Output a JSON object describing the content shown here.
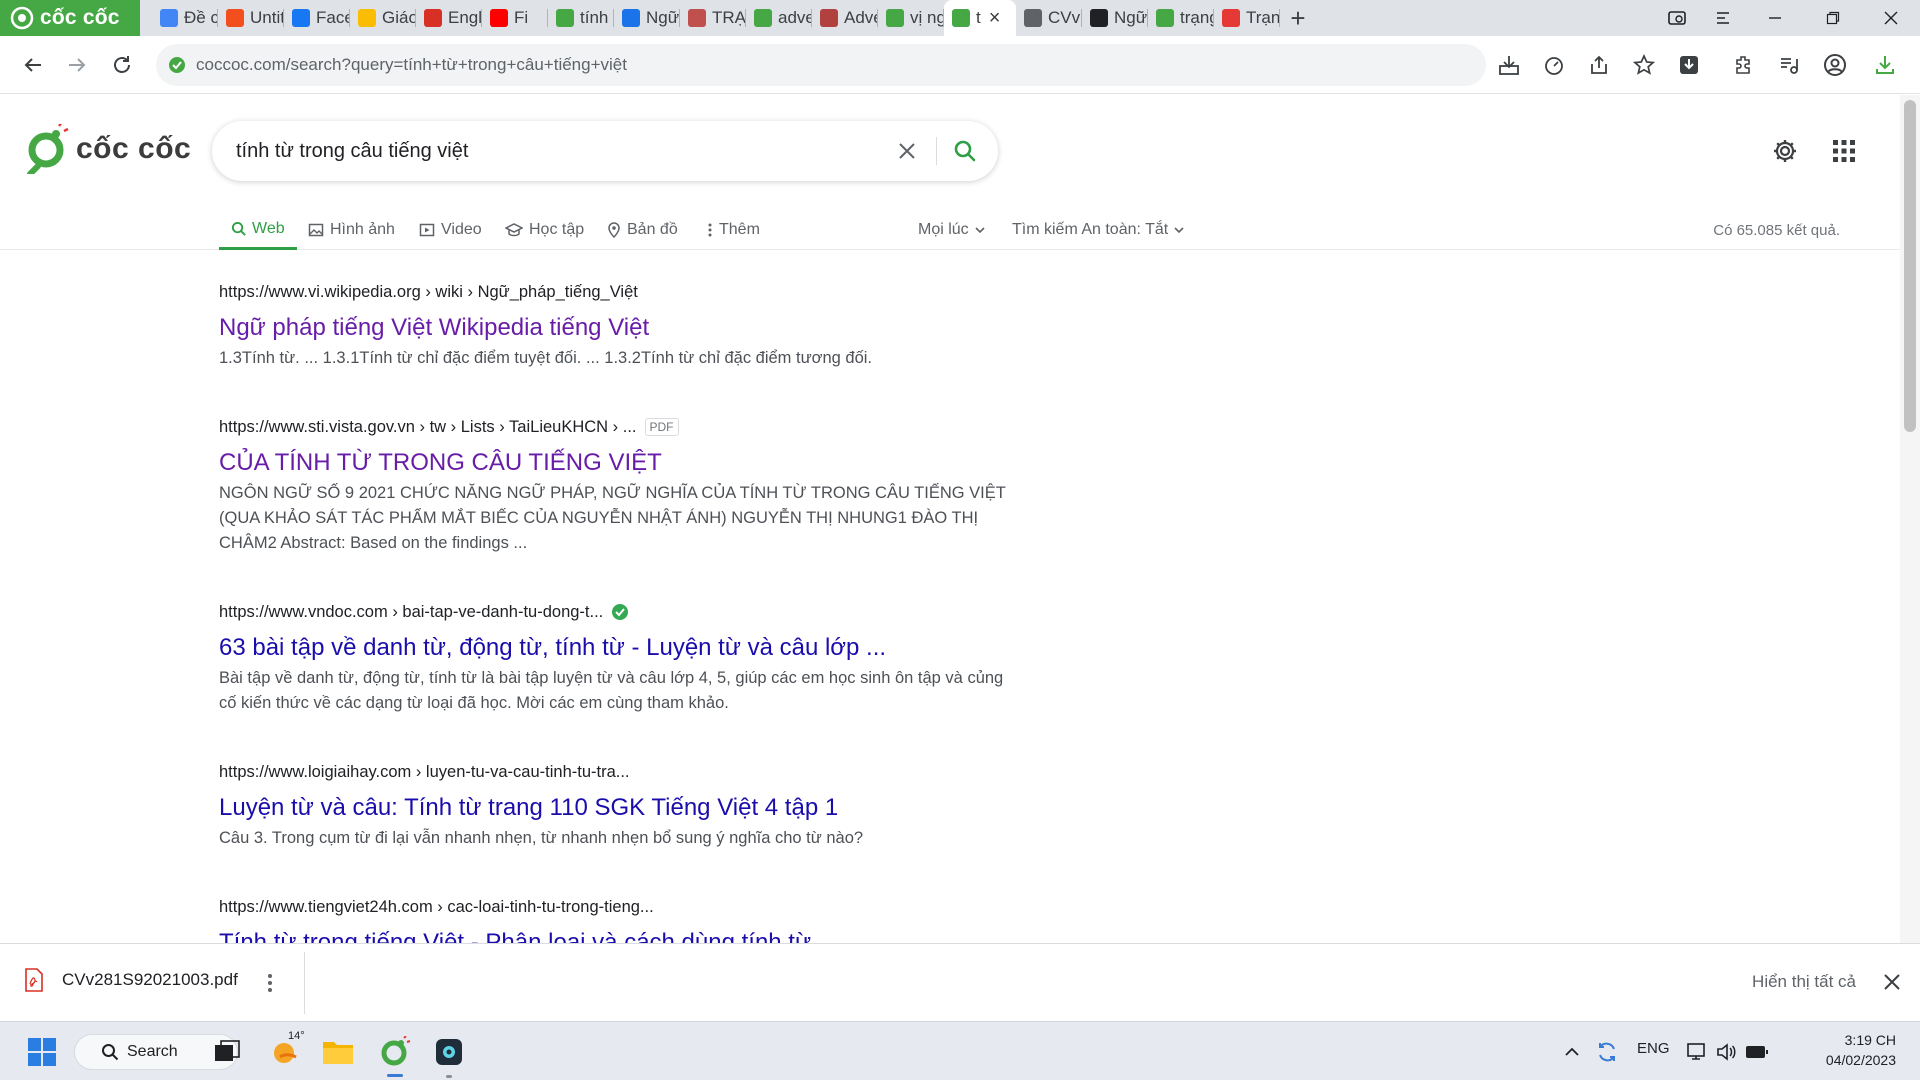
{
  "browser": {
    "name": "cốc cốc"
  },
  "tabs": [
    {
      "label": "Đề cư",
      "favicon": "docs-icon",
      "color": "#4285f4"
    },
    {
      "label": "Untitl",
      "favicon": "figma-icon",
      "color": "#f24e1e"
    },
    {
      "label": "Faceb",
      "favicon": "facebook-icon",
      "color": "#1877f2"
    },
    {
      "label": "Giáo",
      "favicon": "drive-icon",
      "color": "#fbbc04"
    },
    {
      "label": "Engli",
      "favicon": "c-icon",
      "color": "#d93025"
    },
    {
      "label": "Fi",
      "favicon": "youtube-icon",
      "color": "#ff0000"
    },
    {
      "label": "tính",
      "favicon": "coccoc-icon",
      "color": "#46a844"
    },
    {
      "label": "Ngữ",
      "favicon": "arrow-icon",
      "color": "#1a73e8"
    },
    {
      "label": "TRẠI",
      "favicon": "doc-icon",
      "color": "#c0504d"
    },
    {
      "label": "adve",
      "favicon": "coccoc-icon",
      "color": "#46a844"
    },
    {
      "label": "Adve",
      "favicon": "cambridge-icon",
      "color": "#b0413e"
    },
    {
      "label": "vị ng",
      "favicon": "coccoc-icon",
      "color": "#46a844"
    },
    {
      "label": "t",
      "favicon": "coccoc-icon",
      "color": "#46a844",
      "active": true
    },
    {
      "label": "CVv",
      "favicon": "globe-icon",
      "color": "#5f6368"
    },
    {
      "label": "Ngữ",
      "favicon": "wikipedia-icon",
      "color": "#202124"
    },
    {
      "label": "trạng",
      "favicon": "coccoc-icon",
      "color": "#46a844"
    },
    {
      "label": "Trạng",
      "favicon": "red-icon",
      "color": "#e53935"
    }
  ],
  "address": {
    "url": "coccoc.com/search?query=tính+từ+trong+câu+tiếng+việt"
  },
  "search": {
    "query": "tính từ trong câu tiếng việt"
  },
  "filters": {
    "web": "Web",
    "images": "Hình ảnh",
    "video": "Video",
    "learn": "Học tập",
    "maps": "Bản đồ",
    "more": "Thêm",
    "time": "Mọi lúc",
    "safe_search": "Tìm kiếm An toàn: Tắt",
    "count": "Có 65.085 kết quả."
  },
  "results": [
    {
      "url": "https://www.vi.wikipedia.org › wiki › Ngữ_pháp_tiếng_Việt",
      "title": "Ngữ pháp tiếng Việt Wikipedia tiếng Việt",
      "snippet": "1.3Tính từ. ... 1.3.1Tính từ chỉ đặc điểm tuyệt đối. ... 1.3.2Tính từ chỉ đặc điểm tương đối.",
      "visited": true
    },
    {
      "url": "https://www.sti.vista.gov.vn › tw › Lists › TaiLieuKHCN › ...",
      "tag": "PDF",
      "title": "CỦA TÍNH TỪ TRONG CÂU TIẾNG VIỆT",
      "snippet": "NGÔN NGỮ SỐ 9 2021 CHỨC NĂNG NGỮ PHÁP, NGỮ NGHĨA CỦA TÍNH TỪ TRONG CÂU TIẾNG VIỆT (QUA KHẢO SÁT TÁC PHẨM MẮT BIẾC CỦA NGUYỄN NHẬT ÁNH) NGUYỄN THỊ NHUNG1 ĐÀO THỊ CHÂM2 Abstract: Based on the findings ...",
      "visited": true
    },
    {
      "url": "https://www.vndoc.com › bai-tap-ve-danh-tu-dong-t...",
      "verified": true,
      "title": "63 bài tập về danh từ, động từ, tính từ - Luyện từ và câu lớp ...",
      "snippet": "Bài tập về danh từ, động từ, tính từ là bài tập luyện từ và câu lớp 4, 5, giúp các em học sinh ôn tập và củng cố kiến thức về các dạng từ loại đã học. Mời các em cùng tham khảo.",
      "visited": false
    },
    {
      "url": "https://www.loigiaihay.com › luyen-tu-va-cau-tinh-tu-tra...",
      "title": "Luyện từ và câu: Tính từ trang 110 SGK Tiếng Việt 4 tập 1",
      "snippet": "Câu 3. Trong cụm từ đi lại vẫn nhanh nhẹn, từ nhanh nhẹn bổ sung ý nghĩa cho từ nào?",
      "visited": false
    },
    {
      "url": "https://www.tiengviet24h.com › cac-loai-tinh-tu-trong-tieng...",
      "title": "Tính từ trong tiếng Việt - Phân loại và cách dùng tính từ",
      "snippet": "",
      "visited": false
    }
  ],
  "download": {
    "filename": "CVv281S92021003.pdf",
    "show_all": "Hiển thị tất cả"
  },
  "taskbar": {
    "search_label": "Search",
    "weather_temp": "14°",
    "lang": "ENG",
    "time": "3:19 CH",
    "date": "04/02/2023"
  }
}
